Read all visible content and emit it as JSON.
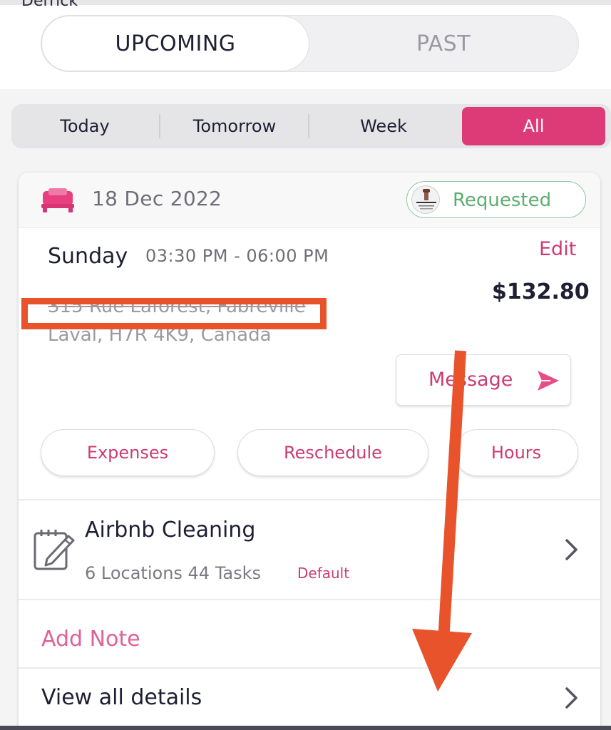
{
  "header": {
    "user_name": "Derrick"
  },
  "segment": {
    "upcoming": "UPCOMING",
    "past": "PAST"
  },
  "filters": {
    "today": "Today",
    "tomorrow": "Tomorrow",
    "week": "Week",
    "all": "All",
    "active": "All"
  },
  "booking": {
    "date": "18 Dec 2022",
    "status": "Requested",
    "day": "Sunday",
    "time_range": "03:30 PM - 06:00 PM",
    "edit_label": "Edit",
    "price": "$132.80",
    "address_line1": "315 Rue Laforest, Fabreville",
    "address_line2": "Laval, H7R 4K9, Canada",
    "message_label": "Message",
    "actions": {
      "expenses": "Expenses",
      "reschedule": "Reschedule",
      "hours": "Hours"
    },
    "service": {
      "title": "Airbnb Cleaning",
      "subtitle": "6 Locations 44 Tasks",
      "tag": "Default"
    },
    "add_note": "Add Note",
    "view_all": "View all details"
  },
  "icons": {
    "bed": "bed-icon",
    "send": "send-icon",
    "notes": "notes-icon",
    "chevron": "chevron-right-icon"
  },
  "colors": {
    "accent": "#dc3b78",
    "accent_text": "#cc3b72",
    "status_green": "#5cae70",
    "annotation_red": "#e8532b"
  }
}
